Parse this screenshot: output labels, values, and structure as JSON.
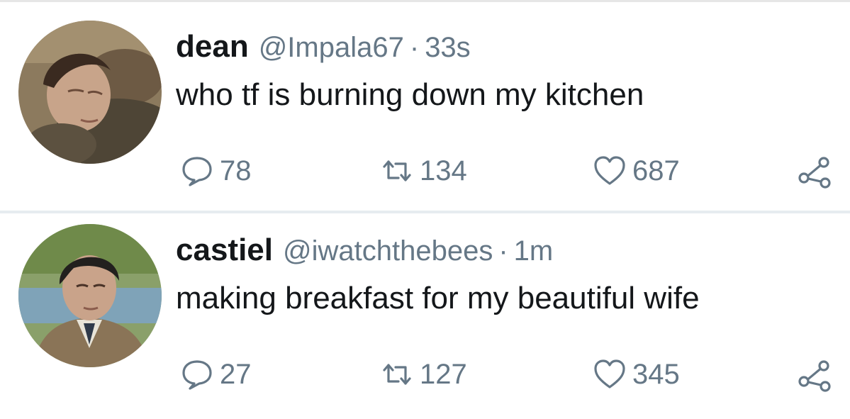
{
  "tweets": [
    {
      "name": "dean",
      "handle": "@Impala67",
      "separator": "·",
      "time": "33s",
      "text": "who tf is burning down my kitchen",
      "replies": "78",
      "retweets": "134",
      "likes": "687",
      "avatar_icon": "avatar-dean"
    },
    {
      "name": "castiel",
      "handle": "@iwatchthebees",
      "separator": "·",
      "time": "1m",
      "text": "making breakfast for my beautiful wife",
      "replies": "27",
      "retweets": "127",
      "likes": "345",
      "avatar_icon": "avatar-castiel"
    }
  ],
  "icons": {
    "reply": "speech-bubble-icon",
    "retweet": "retweet-arrows-icon",
    "like": "heart-icon",
    "share": "share-nodes-icon"
  },
  "colors": {
    "text": "#14171a",
    "muted": "#657786",
    "divider": "#e6ecf0"
  }
}
